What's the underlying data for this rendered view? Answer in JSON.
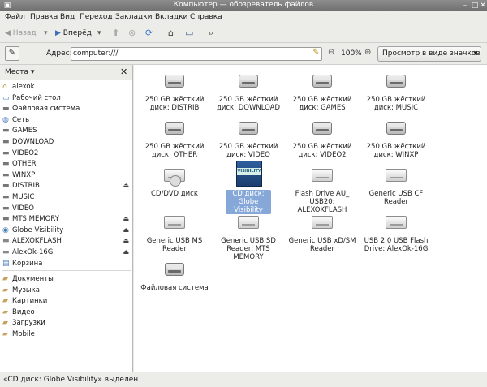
{
  "window": {
    "title": "Компьютер — обозреватель файлов"
  },
  "menu": [
    "Файл",
    "Правка",
    "Вид",
    "Переход",
    "Закладки",
    "Вкладки",
    "Справка"
  ],
  "toolbar": {
    "back_label": "Назад",
    "forward_label": "Вперёд"
  },
  "address": {
    "label": "Адрес:",
    "value": "computer:///",
    "zoom": "100%",
    "view_mode": "Просмотр в виде значков"
  },
  "sidebar": {
    "header": "Места",
    "places": [
      {
        "label": "alexok",
        "icon": "home-icon"
      },
      {
        "label": "Рабочий стол",
        "icon": "desktop-icon"
      },
      {
        "label": "Файловая система",
        "icon": "drive-icon"
      },
      {
        "label": "Сеть",
        "icon": "network-icon"
      },
      {
        "label": "GAMES",
        "icon": "drive-icon"
      },
      {
        "label": "DOWNLOAD",
        "icon": "drive-icon"
      },
      {
        "label": "VIDEO2",
        "icon": "drive-icon"
      },
      {
        "label": "OTHER",
        "icon": "drive-icon"
      },
      {
        "label": "WINXP",
        "icon": "drive-icon"
      },
      {
        "label": "DISTRIB",
        "icon": "drive-icon",
        "eject": true
      },
      {
        "label": "MUSIC",
        "icon": "drive-icon"
      },
      {
        "label": "VIDEO",
        "icon": "drive-icon"
      },
      {
        "label": "MTS MEMORY",
        "icon": "drive-icon",
        "eject": true
      },
      {
        "label": "Globe Visibility",
        "icon": "cd-icon",
        "eject": true
      },
      {
        "label": "ALEXOKFLASH",
        "icon": "usb-icon",
        "eject": true
      },
      {
        "label": "AlexOk-16G",
        "icon": "usb-icon",
        "eject": true
      },
      {
        "label": "Корзина",
        "icon": "trash-icon"
      }
    ],
    "bookmarks": [
      {
        "label": "Документы"
      },
      {
        "label": "Музыка"
      },
      {
        "label": "Картинки"
      },
      {
        "label": "Видео"
      },
      {
        "label": "Загрузки"
      },
      {
        "label": "Mobile"
      }
    ]
  },
  "items": [
    {
      "label": "250 GB жёсткий диск: DISTRIB",
      "kind": "hdd"
    },
    {
      "label": "250 GB жёсткий диск: DOWNLOAD",
      "kind": "hdd"
    },
    {
      "label": "250 GB жёсткий диск: GAMES",
      "kind": "hdd"
    },
    {
      "label": "250 GB жёсткий диск: MUSIC",
      "kind": "hdd"
    },
    {
      "label": "250 GB жёсткий диск: OTHER",
      "kind": "hdd"
    },
    {
      "label": "250 GB жёсткий диск: VIDEO",
      "kind": "hdd"
    },
    {
      "label": "250 GB жёсткий диск: VIDEO2",
      "kind": "hdd"
    },
    {
      "label": "250 GB жёсткий диск: WINXP",
      "kind": "hdd"
    },
    {
      "label": "CD/DVD диск",
      "kind": "cdrom"
    },
    {
      "label": "CD диск: Globe Visibility",
      "kind": "cd",
      "selected": true,
      "icon_text": "VISIBILITY"
    },
    {
      "label": "Flash Drive AU_ USB20: ALEXOKFLASH",
      "kind": "usb"
    },
    {
      "label": "Generic USB CF Reader",
      "kind": "usb"
    },
    {
      "label": "Generic USB MS Reader",
      "kind": "usb"
    },
    {
      "label": "Generic USB SD Reader: MTS MEMORY",
      "kind": "usb"
    },
    {
      "label": "Generic USB xD/SM Reader",
      "kind": "usb"
    },
    {
      "label": "USB 2.0 USB Flash Drive: AlexOk-16G",
      "kind": "usb"
    },
    {
      "label": "Файловая система",
      "kind": "hdd"
    }
  ],
  "status": {
    "text": "«CD диск: Globe Visibility» выделен"
  },
  "colors": {
    "selection": "#86a8d9",
    "titlebar": "#7b7b7b"
  }
}
